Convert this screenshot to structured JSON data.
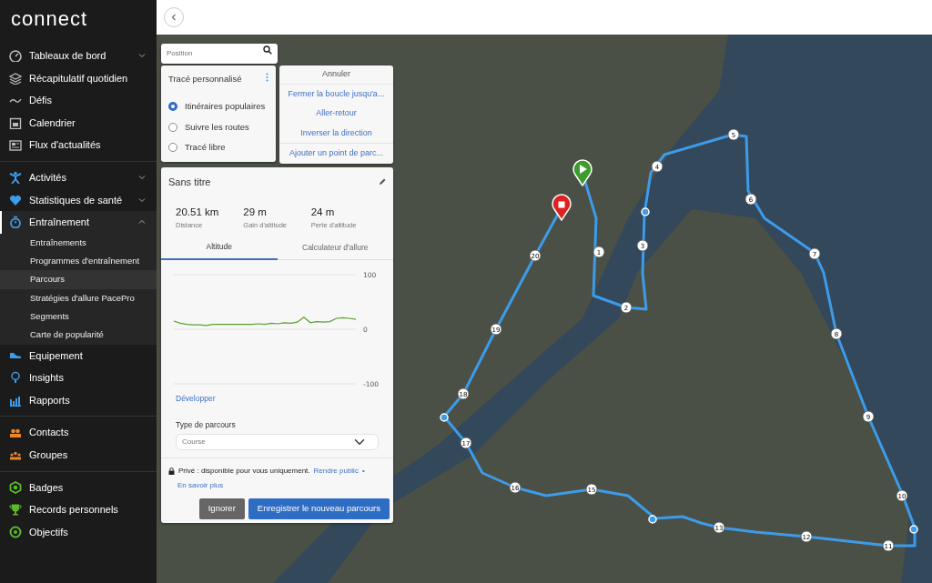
{
  "logo": "connect",
  "sidebar": {
    "sections": [
      {
        "items": [
          {
            "label": "Tableaux de bord",
            "selected": false,
            "expanded": false
          },
          {
            "label": "Récapitulatif quotidien",
            "selected": false
          },
          {
            "label": "Défis",
            "selected": false
          },
          {
            "label": "Calendrier",
            "selected": false
          },
          {
            "label": "Flux d'actualités",
            "selected": false
          }
        ]
      },
      {
        "items": [
          {
            "label": "Activités",
            "selected": false,
            "expanded": false
          },
          {
            "label": "Statistiques de santé",
            "selected": false,
            "expanded": false
          },
          {
            "label": "Entraînement",
            "selected": true,
            "expanded": true,
            "children": [
              {
                "label": "Entraînements",
                "selected": false
              },
              {
                "label": "Programmes d'entraînement",
                "selected": false
              },
              {
                "label": "Parcours",
                "selected": true
              },
              {
                "label": "Stratégies d'allure PacePro",
                "selected": false
              },
              {
                "label": "Segments",
                "selected": false
              },
              {
                "label": "Carte de popularité",
                "selected": false
              }
            ]
          },
          {
            "label": "Equipement",
            "selected": false
          },
          {
            "label": "Insights",
            "selected": false
          },
          {
            "label": "Rapports",
            "selected": false
          }
        ]
      },
      {
        "items": [
          {
            "label": "Contacts",
            "selected": false
          },
          {
            "label": "Groupes",
            "selected": false
          }
        ]
      },
      {
        "items": [
          {
            "label": "Badges",
            "selected": false
          },
          {
            "label": "Records personnels",
            "selected": false
          },
          {
            "label": "Objectifs",
            "selected": false
          }
        ]
      }
    ]
  },
  "search": {
    "placeholder": "Position"
  },
  "trace_panel": {
    "title": "Tracé personnalisé",
    "options": [
      {
        "label": "Itinéraires populaires",
        "selected": true
      },
      {
        "label": "Suivre les routes",
        "selected": false
      },
      {
        "label": "Tracé libre",
        "selected": false
      }
    ]
  },
  "actions_panel": {
    "cancel": "Annuler",
    "actions": [
      "Fermer la boucle jusqu'a...",
      "Aller-retour",
      "Inverser la direction",
      "Ajouter un point de parc..."
    ]
  },
  "route_card": {
    "title": "Sans titre",
    "stats": [
      {
        "value": "20.51 km",
        "label": "Distance"
      },
      {
        "value": "29 m",
        "label": "Gain d'altitude"
      },
      {
        "value": "24 m",
        "label": "Perte d'altitude"
      }
    ],
    "tabs": [
      {
        "label": "Altitude",
        "selected": true
      },
      {
        "label": "Calculateur d'allure",
        "selected": false
      }
    ],
    "chart_data": {
      "type": "line",
      "ylim": [
        -100,
        100
      ],
      "yticks": [
        {
          "value": 100,
          "label": "100"
        },
        {
          "value": 0,
          "label": "0"
        },
        {
          "value": -100,
          "label": "-100"
        }
      ],
      "series": [
        {
          "color": "#5aa02c",
          "values": [
            15,
            11,
            9,
            8,
            8,
            7,
            9,
            9,
            9,
            9,
            9,
            9,
            9,
            10,
            9,
            11,
            10,
            12,
            11,
            13,
            22,
            12,
            14,
            13,
            14,
            20,
            21,
            20,
            18
          ]
        }
      ]
    },
    "expand_link": "Développer",
    "type_label": "Type de parcours",
    "type_value": "Course",
    "privacy_text": "Privé : disponible pour vous uniquement.",
    "make_public": "Rendre public",
    "bullet": "•",
    "learn_more": "En savoir plus",
    "buttons": [
      {
        "label": "Ignorer",
        "kind": "secondary"
      },
      {
        "label": "Enregistrer le nouveau parcours",
        "kind": "primary"
      }
    ]
  },
  "map": {
    "markers": [
      {
        "label": "1"
      },
      {
        "label": "2"
      },
      {
        "label": "3"
      },
      {
        "label": "4"
      },
      {
        "label": "5"
      },
      {
        "label": "6"
      },
      {
        "label": "7"
      },
      {
        "label": "8"
      },
      {
        "label": "9"
      },
      {
        "label": "10"
      },
      {
        "label": "11"
      },
      {
        "label": "12"
      },
      {
        "label": "13"
      },
      {
        "label": "15"
      },
      {
        "label": "16"
      },
      {
        "label": "17"
      },
      {
        "label": "18"
      },
      {
        "label": "19"
      },
      {
        "label": "20"
      }
    ]
  }
}
